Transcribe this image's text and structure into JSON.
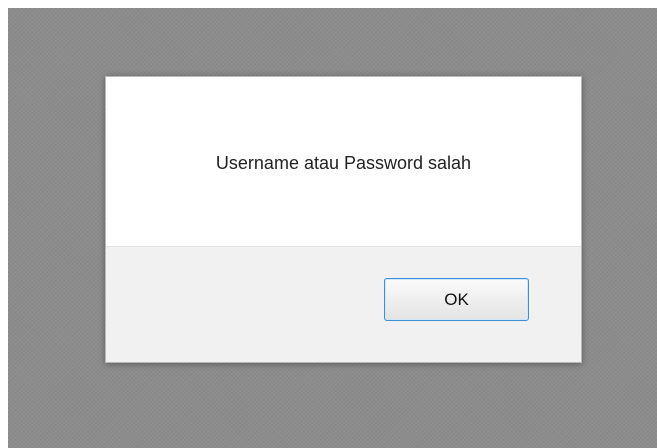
{
  "dialog": {
    "message": "Username atau Password salah",
    "ok_label": "OK"
  },
  "colors": {
    "overlay": "#8c8c8c",
    "button_border": "#3f8fd6",
    "footer": "#f1f1f1"
  }
}
